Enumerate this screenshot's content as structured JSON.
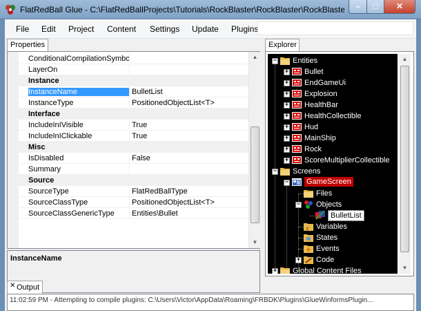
{
  "window": {
    "title": "FlatRedBall Glue - C:\\FlatRedBallProjects\\Tutorials\\RockBlaster\\RockBlaster\\RockBlaste...",
    "minimize_glyph": "–",
    "maximize_glyph": "□",
    "close_glyph": "✕"
  },
  "menu": {
    "items": [
      "File",
      "Edit",
      "Project",
      "Content",
      "Settings",
      "Update",
      "Plugins"
    ]
  },
  "properties": {
    "tab_label": "Properties",
    "rows": [
      {
        "type": "prop",
        "name": "ConditionalCompilationSymbols",
        "value": ""
      },
      {
        "type": "prop",
        "name": "LayerOn",
        "value": ""
      },
      {
        "type": "category",
        "name": "Instance"
      },
      {
        "type": "prop",
        "name": "InstanceName",
        "value": "BulletList",
        "selected": true
      },
      {
        "type": "prop",
        "name": "InstanceType",
        "value": "PositionedObjectList<T>"
      },
      {
        "type": "category",
        "name": "Interface"
      },
      {
        "type": "prop",
        "name": "IncludeInIVisible",
        "value": "True"
      },
      {
        "type": "prop",
        "name": "IncludeInIClickable",
        "value": "True"
      },
      {
        "type": "category",
        "name": "Misc"
      },
      {
        "type": "prop",
        "name": "IsDisabled",
        "value": "False"
      },
      {
        "type": "prop",
        "name": "Summary",
        "value": ""
      },
      {
        "type": "category",
        "name": "Source"
      },
      {
        "type": "prop",
        "name": "SourceType",
        "value": "FlatRedBallType"
      },
      {
        "type": "prop",
        "name": "SourceClassType",
        "value": "PositionedObjectList<T>"
      },
      {
        "type": "prop",
        "name": "SourceClassGenericType",
        "value": "Entities\\Bullet"
      }
    ],
    "description_title": "InstanceName"
  },
  "explorer": {
    "tab_label": "Explorer",
    "tree": [
      {
        "label": "Entities",
        "level": 0,
        "expander": "minus",
        "icon": "folder-icon"
      },
      {
        "label": "Bullet",
        "level": 1,
        "expander": "plus",
        "icon": "entity-icon"
      },
      {
        "label": "EndGameUi",
        "level": 1,
        "expander": "plus",
        "icon": "entity-icon"
      },
      {
        "label": "Explosion",
        "level": 1,
        "expander": "plus",
        "icon": "entity-icon"
      },
      {
        "label": "HealthBar",
        "level": 1,
        "expander": "plus",
        "icon": "entity-icon"
      },
      {
        "label": "HealthCollectible",
        "level": 1,
        "expander": "plus",
        "icon": "entity-icon"
      },
      {
        "label": "Hud",
        "level": 1,
        "expander": "plus",
        "icon": "entity-icon"
      },
      {
        "label": "MainShip",
        "level": 1,
        "expander": "plus",
        "icon": "entity-icon"
      },
      {
        "label": "Rock",
        "level": 1,
        "expander": "plus",
        "icon": "entity-icon"
      },
      {
        "label": "ScoreMultiplierCollectible",
        "level": 1,
        "expander": "plus",
        "icon": "entity-icon"
      },
      {
        "label": "Screens",
        "level": 0,
        "expander": "minus",
        "icon": "folder-icon"
      },
      {
        "label": "GameScreen",
        "level": 1,
        "expander": "minus",
        "icon": "screen-icon",
        "highlight": "red"
      },
      {
        "label": "Files",
        "level": 2,
        "expander": "none",
        "icon": "folder-icon"
      },
      {
        "label": "Objects",
        "level": 2,
        "expander": "minus",
        "icon": "objects-icon"
      },
      {
        "label": "BulletList",
        "level": 3,
        "expander": "none",
        "icon": "list-icon",
        "highlight": "white"
      },
      {
        "label": "Variables",
        "level": 2,
        "expander": "none",
        "icon": "variables-icon"
      },
      {
        "label": "States",
        "level": 2,
        "expander": "none",
        "icon": "states-icon"
      },
      {
        "label": "Events",
        "level": 2,
        "expander": "none",
        "icon": "events-icon"
      },
      {
        "label": "Code",
        "level": 2,
        "expander": "plus",
        "icon": "code-icon"
      },
      {
        "label": "Global Content Files",
        "level": 0,
        "expander": "plus",
        "icon": "folder-icon"
      }
    ]
  },
  "output": {
    "tab_label": "Output",
    "close_glyph": "✕",
    "text": "11:02:59 PM - Attempting to compile plugins: C:\\Users\\Victor\\AppData\\Roaming\\FRBDK\\Plugins\\GlueWinformsPlugin..."
  },
  "colors": {
    "selection_blue": "#3399ff",
    "tree_background": "#000000",
    "tree_highlight_red": "#c00000",
    "entity_icon_red": "#d81010",
    "folder_yellow": "#e8b84a"
  }
}
